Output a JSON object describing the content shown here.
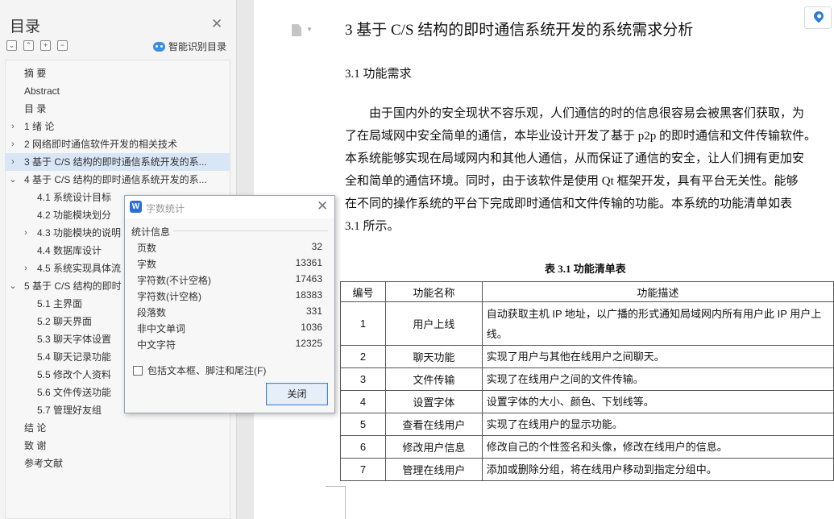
{
  "sidebar": {
    "title": "目录",
    "smart_label": "智能识别目录",
    "tools": [
      "⌄",
      "⌃",
      "+",
      "−"
    ],
    "items": [
      {
        "label": "摘  要",
        "level": 1,
        "chevron": ""
      },
      {
        "label": "Abstract",
        "level": 1,
        "chevron": ""
      },
      {
        "label": "目  录",
        "level": 1,
        "chevron": ""
      },
      {
        "label": "1  绪  论",
        "level": 1,
        "chevron": "›"
      },
      {
        "label": "2  网络即时通信软件开发的相关技术",
        "level": 1,
        "chevron": "›"
      },
      {
        "label": "3  基于 C/S 结构的即时通信系统开发的系...",
        "level": 1,
        "chevron": "›",
        "active": true
      },
      {
        "label": "4  基于 C/S 结构的即时通信系统开发的系...",
        "level": 1,
        "chevron": "⌄"
      },
      {
        "label": "4.1  系统设计目标",
        "level": 2,
        "chevron": ""
      },
      {
        "label": "4.2  功能模块划分",
        "level": 2,
        "chevron": ""
      },
      {
        "label": "4.3  功能模块的说明",
        "level": 2,
        "chevron": "›"
      },
      {
        "label": "4.4  数据库设计",
        "level": 2,
        "chevron": ""
      },
      {
        "label": "4.5  系统实现具体流",
        "level": 2,
        "chevron": "›"
      },
      {
        "label": "5  基于 C/S 结构的即时",
        "level": 1,
        "chevron": "⌄"
      },
      {
        "label": "5.1  主界面",
        "level": 2,
        "chevron": ""
      },
      {
        "label": "5.2  聊天界面",
        "level": 2,
        "chevron": ""
      },
      {
        "label": "5.3  聊天字体设置",
        "level": 2,
        "chevron": ""
      },
      {
        "label": "5.4  聊天记录功能",
        "level": 2,
        "chevron": ""
      },
      {
        "label": "5.5  修改个人资料",
        "level": 2,
        "chevron": ""
      },
      {
        "label": "5.6  文件传送功能",
        "level": 2,
        "chevron": ""
      },
      {
        "label": "5.7  管理好友组",
        "level": 2,
        "chevron": ""
      },
      {
        "label": "结  论",
        "level": 1,
        "chevron": ""
      },
      {
        "label": "致  谢",
        "level": 1,
        "chevron": ""
      },
      {
        "label": "参考文献",
        "level": 1,
        "chevron": ""
      }
    ]
  },
  "document": {
    "heading": "3  基于 C/S 结构的即时通信系统开发的系统需求分析",
    "subheading": "3.1  功能需求",
    "paragraph_lines": [
      "由于国内外的安全现状不容乐观，人们通信的时的信息很容易会被黑客们获取，为",
      "了在局域网中安全简单的通信，本毕业设计开发了基于 p2p 的即时通信和文件传输软件。",
      "本系统能够实现在局域网内和其他人通信，从而保证了通信的安全，让人们拥有更加安",
      "全和简单的通信环境。同时，由于该软件是使用 Qt 框架开发，具有平台无关性。能够",
      "在不同的操作系统的平台下完成即时通信和文件传输的功能。本系统的功能清单如表",
      "3.1 所示。"
    ],
    "table_caption": "表 3.1  功能清单表",
    "table": {
      "headers": [
        "编号",
        "功能名称",
        "功能描述"
      ],
      "rows": [
        [
          "1",
          "用户上线",
          "自动获取主机 IP 地址，以广播的形式通知局域网内所有用户此 IP 用户上线。"
        ],
        [
          "2",
          "聊天功能",
          "实现了用户与其他在线用户之间聊天。"
        ],
        [
          "3",
          "文件传输",
          "实现了在线用户之间的文件传输。"
        ],
        [
          "4",
          "设置字体",
          "设置字体的大小、颜色、下划线等。"
        ],
        [
          "5",
          "查看在线用户",
          "实现了在线用户的显示功能。"
        ],
        [
          "6",
          "修改用户信息",
          "修改自己的个性签名和头像，修改在线用户的信息。"
        ],
        [
          "7",
          "管理在线用户",
          "添加或删除分组，将在线用户移动到指定分组中。"
        ]
      ]
    }
  },
  "dialog": {
    "app_icon_letter": "W",
    "title": "字数统计",
    "group_label": "统计信息",
    "stats": [
      {
        "label": "页数",
        "value": "32"
      },
      {
        "label": "字数",
        "value": "13361"
      },
      {
        "label": "字符数(不计空格)",
        "value": "17463"
      },
      {
        "label": "字符数(计空格)",
        "value": "18383"
      },
      {
        "label": "段落数",
        "value": "331"
      },
      {
        "label": "非中文单词",
        "value": "1036"
      },
      {
        "label": "中文字符",
        "value": "12325"
      }
    ],
    "checkbox_label": "包括文本框、脚注和尾注(F)",
    "checkbox_checked": false,
    "close_button": "关闭"
  }
}
